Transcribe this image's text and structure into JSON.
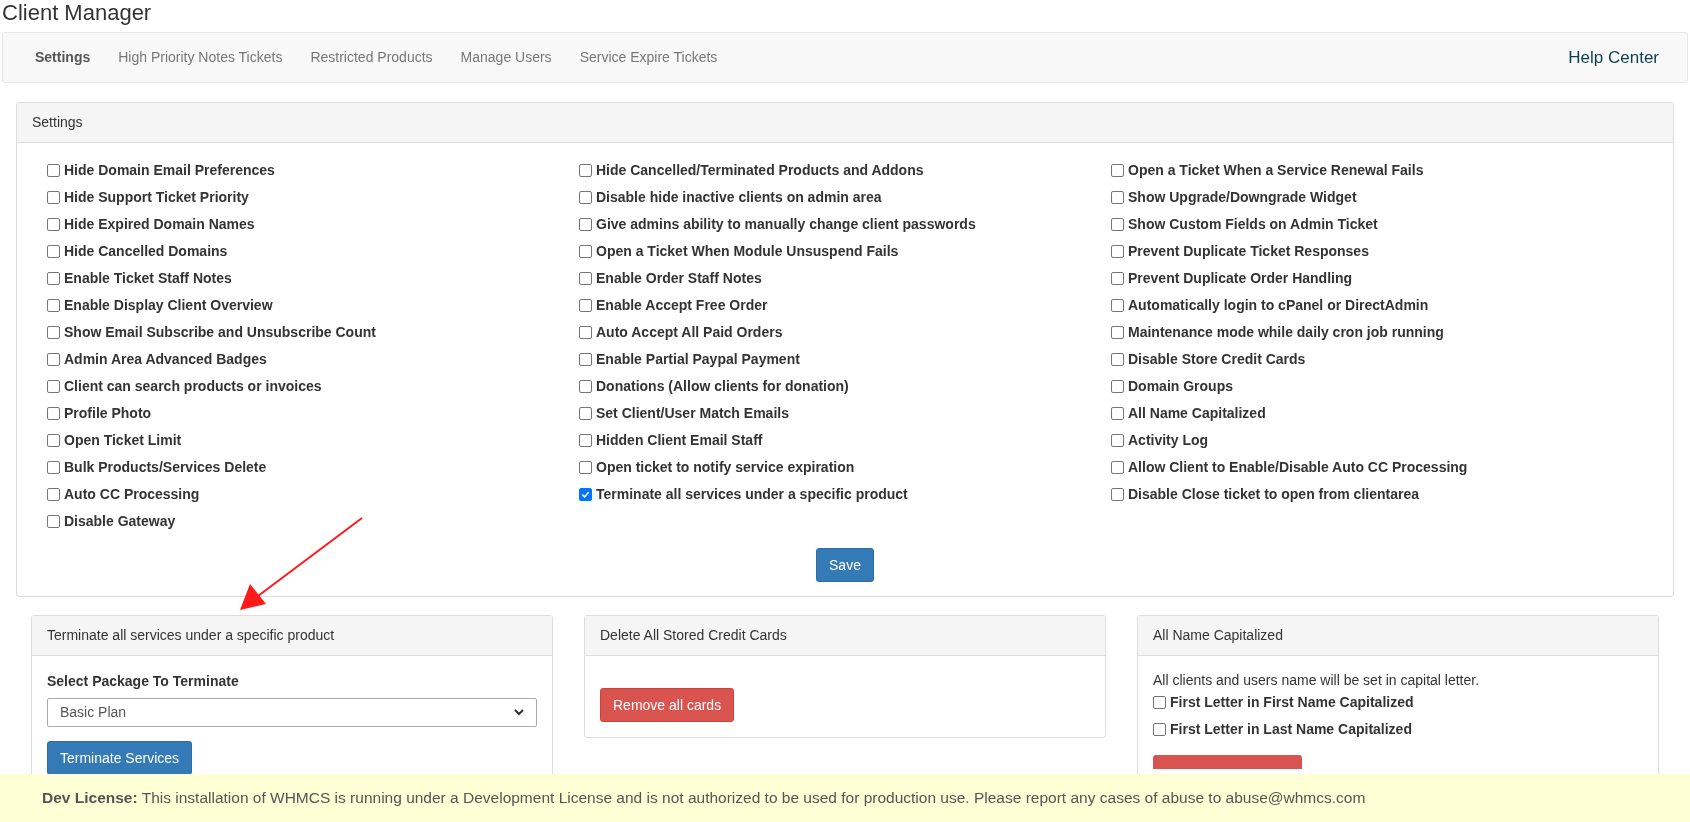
{
  "page_title": "Client Manager",
  "nav": {
    "tabs": [
      {
        "label": "Settings",
        "selected": true
      },
      {
        "label": "High Priority Notes Tickets",
        "selected": false
      },
      {
        "label": "Restricted Products",
        "selected": false
      },
      {
        "label": "Manage Users",
        "selected": false
      },
      {
        "label": "Service Expire Tickets",
        "selected": false
      }
    ],
    "help_link": "Help Center"
  },
  "settings": {
    "title": "Settings",
    "columns": [
      [
        {
          "label": "Hide Domain Email Preferences",
          "checked": false
        },
        {
          "label": "Hide Support Ticket Priority",
          "checked": false
        },
        {
          "label": "Hide Expired Domain Names",
          "checked": false
        },
        {
          "label": "Hide Cancelled Domains",
          "checked": false
        },
        {
          "label": "Enable Ticket Staff Notes",
          "checked": false
        },
        {
          "label": "Enable Display Client Overview",
          "checked": false
        },
        {
          "label": "Show Email Subscribe and Unsubscribe Count",
          "checked": false
        },
        {
          "label": "Admin Area Advanced Badges",
          "checked": false
        },
        {
          "label": "Client can search products or invoices",
          "checked": false
        },
        {
          "label": "Profile Photo",
          "checked": false
        },
        {
          "label": "Open Ticket Limit",
          "checked": false
        },
        {
          "label": "Bulk Products/Services Delete",
          "checked": false
        },
        {
          "label": "Auto CC Processing",
          "checked": false
        },
        {
          "label": "Disable Gateway",
          "checked": false
        }
      ],
      [
        {
          "label": "Hide Cancelled/Terminated Products and Addons",
          "checked": false
        },
        {
          "label": "Disable hide inactive clients on admin area",
          "checked": false
        },
        {
          "label": "Give admins ability to manually change client passwords",
          "checked": false
        },
        {
          "label": "Open a Ticket When Module Unsuspend Fails",
          "checked": false
        },
        {
          "label": "Enable Order Staff Notes",
          "checked": false
        },
        {
          "label": "Enable Accept Free Order",
          "checked": false
        },
        {
          "label": "Auto Accept All Paid Orders",
          "checked": false
        },
        {
          "label": "Enable Partial Paypal Payment",
          "checked": false
        },
        {
          "label": "Donations (Allow clients for donation)",
          "checked": false
        },
        {
          "label": "Set Client/User Match Emails",
          "checked": false
        },
        {
          "label": "Hidden Client Email Staff",
          "checked": false
        },
        {
          "label": "Open ticket to notify service expiration",
          "checked": false
        },
        {
          "label": "Terminate all services under a specific product",
          "checked": true
        }
      ],
      [
        {
          "label": "Open a Ticket When a Service Renewal Fails",
          "checked": false
        },
        {
          "label": "Show Upgrade/Downgrade Widget",
          "checked": false
        },
        {
          "label": "Show Custom Fields on Admin Ticket",
          "checked": false
        },
        {
          "label": "Prevent Duplicate Ticket Responses",
          "checked": false
        },
        {
          "label": "Prevent Duplicate Order Handling",
          "checked": false
        },
        {
          "label": "Automatically login to cPanel or DirectAdmin",
          "checked": false
        },
        {
          "label": "Maintenance mode while daily cron job running",
          "checked": false
        },
        {
          "label": "Disable Store Credit Cards",
          "checked": false
        },
        {
          "label": "Domain Groups",
          "checked": false
        },
        {
          "label": "All Name Capitalized",
          "checked": false
        },
        {
          "label": "Activity Log",
          "checked": false
        },
        {
          "label": "Allow Client to Enable/Disable Auto CC Processing",
          "checked": false
        },
        {
          "label": "Disable Close ticket to open from clientarea",
          "checked": false
        }
      ]
    ],
    "save_button": "Save"
  },
  "terminate_panel": {
    "title": "Terminate all services under a specific product",
    "field_label": "Select Package To Terminate",
    "select_value": "Basic Plan",
    "button": "Terminate Services"
  },
  "cards_panel": {
    "title": "Delete All Stored Credit Cards",
    "button": "Remove all cards"
  },
  "capitalize_panel": {
    "title": "All Name Capitalized",
    "description": "All clients and users name will be set in capital letter.",
    "options": [
      {
        "label": "First Letter in First Name Capitalized",
        "checked": false
      },
      {
        "label": "First Letter in Last Name Capitalized",
        "checked": false
      }
    ]
  },
  "license_banner": {
    "label": "Dev License:",
    "message": "This installation of WHMCS is running under a Development License and is not authorized to be used for production use. Please report any cases of abuse to abuse@whmcs.com"
  }
}
